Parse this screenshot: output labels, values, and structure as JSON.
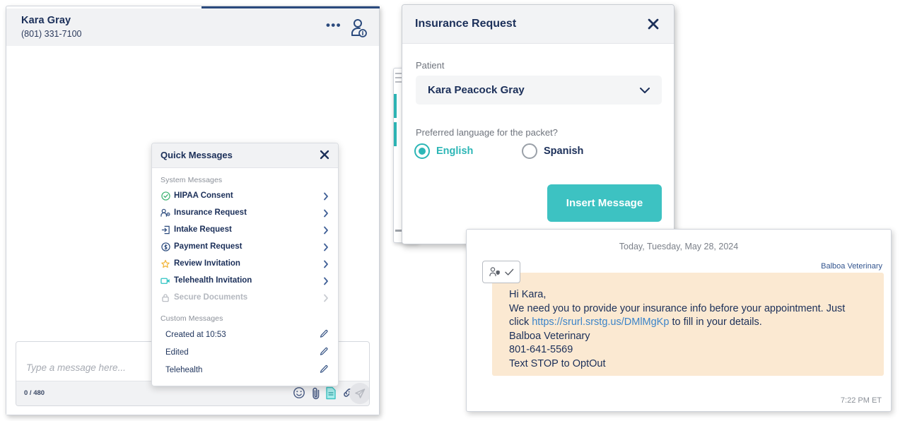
{
  "conversation": {
    "contact_name": "Kara Gray",
    "contact_phone": "(801) 331-7100",
    "more_button_label": "•••",
    "patient_info_icon": "patient-info-icon",
    "composer": {
      "placeholder": "Type a message here...",
      "value": "",
      "char_count": "0 / 480",
      "tools": [
        {
          "name": "emoji-icon",
          "label": "Emoji"
        },
        {
          "name": "paperclip-icon",
          "label": "Attach file"
        },
        {
          "name": "document-icon",
          "label": "Secure document"
        },
        {
          "name": "link-icon",
          "label": "Insert link"
        },
        {
          "name": "send-icon",
          "label": "Send"
        }
      ]
    }
  },
  "quick_messages": {
    "title": "Quick Messages",
    "close_label": "✕",
    "system_section_label": "System Messages",
    "custom_section_label": "Custom Messages",
    "system_items": [
      {
        "label": "HIPAA Consent",
        "icon": "check-circle-icon",
        "color": "#3cb371",
        "disabled": false
      },
      {
        "label": "Insurance Request",
        "icon": "person-gear-icon",
        "color": "#2b4a7d",
        "disabled": false
      },
      {
        "label": "Intake Request",
        "icon": "form-import-icon",
        "color": "#2b4a7d",
        "disabled": false
      },
      {
        "label": "Payment Request",
        "icon": "dollar-circle-icon",
        "color": "#2b4a7d",
        "disabled": false
      },
      {
        "label": "Review Invitation",
        "icon": "star-icon",
        "color": "#f2b53a",
        "disabled": false
      },
      {
        "label": "Telehealth Invitation",
        "icon": "video-camera-icon",
        "color": "#2cc2c2",
        "disabled": false
      },
      {
        "label": "Secure Documents",
        "icon": "lock-icon",
        "color": "#b4b8bf",
        "disabled": true
      }
    ],
    "custom_items": [
      {
        "label": "Created at 10:53",
        "edit_icon": "pencil-icon"
      },
      {
        "label": "Edited",
        "edit_icon": "pencil-icon"
      },
      {
        "label": "Telehealth",
        "edit_icon": "pencil-icon"
      }
    ]
  },
  "insurance_dialog": {
    "title": "Insurance Request",
    "close_label": "✕",
    "patient_label": "Patient",
    "patient_value": "Kara Peacock Gray",
    "patient_options": [
      "Kara Peacock Gray"
    ],
    "language_label": "Preferred language for the packet?",
    "languages": [
      {
        "label": "English",
        "selected": true
      },
      {
        "label": "Spanish",
        "selected": false
      }
    ],
    "insert_button_label": "Insert Message"
  },
  "message_card": {
    "date_divider": "Today, Tuesday, May 28, 2024",
    "sender": "Balboa Veterinary",
    "badge_icon": "person-shield-check-icon",
    "timestamp": "7:22 PM ET",
    "body_lines": [
      "Hi Kara,",
      "We need you to provide your insurance info before your appointment. Just",
      "Balboa Veterinary",
      "801-641-5569",
      "Text STOP to OptOut"
    ],
    "link_line_prefix": "click ",
    "link_text": "https://srurl.srstg.us/DMlMgKp",
    "link_line_suffix": " to fill in your details."
  },
  "colors": {
    "navy": "#1b2f59",
    "teal": "#2cb6b6",
    "bubble_bg": "#fbe9d2",
    "link_blue": "#3c84c9",
    "header_gray": "#f1f2f4"
  }
}
